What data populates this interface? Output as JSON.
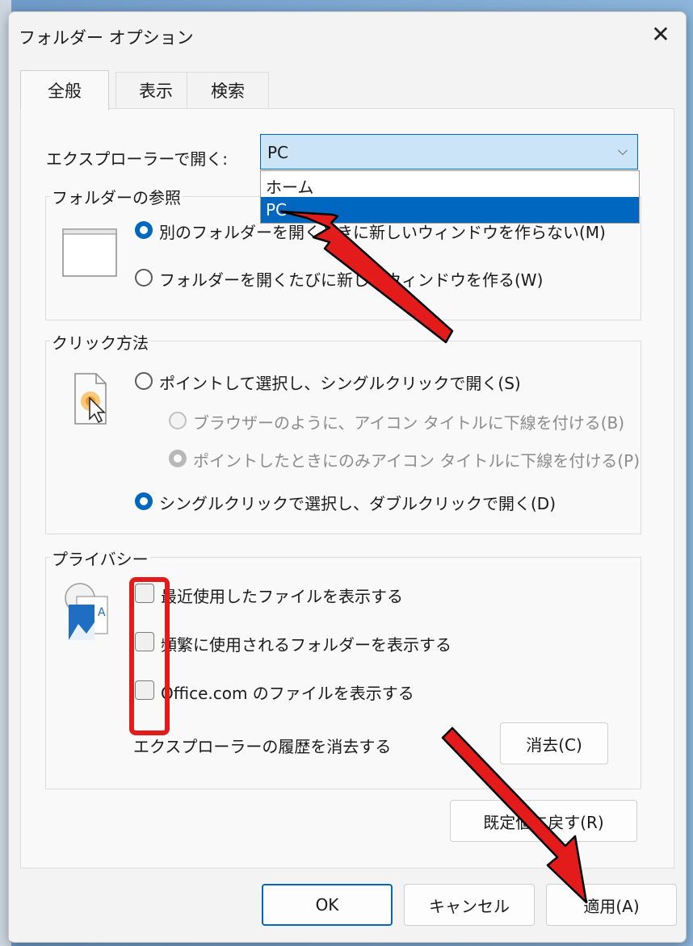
{
  "window": {
    "title": "フォルダー オプション"
  },
  "tabs": [
    {
      "label": "全般",
      "active": true
    },
    {
      "label": "表示",
      "active": false
    },
    {
      "label": "検索",
      "active": false
    }
  ],
  "general": {
    "open_explorer_label": "エクスプローラーで開く:",
    "open_explorer_value": "PC",
    "dropdown_options": [
      "ホーム",
      "PC"
    ],
    "dropdown_selected": "PC",
    "browse_folders": {
      "legend": "フォルダーの参照",
      "options": [
        {
          "label": "別のフォルダーを開くときに新しいウィンドウを作らない(M)",
          "checked": true
        },
        {
          "label": "フォルダーを開くたびに新しいウィンドウを作る(W)",
          "checked": false
        }
      ]
    },
    "click_method": {
      "legend": "クリック方法",
      "options": [
        {
          "label": "ポイントして選択し、シングルクリックで開く(S)",
          "checked": false,
          "enabled": true
        },
        {
          "label": "ブラウザーのように、アイコン タイトルに下線を付ける(B)",
          "checked": false,
          "enabled": false
        },
        {
          "label": "ポイントしたときにのみアイコン タイトルに下線を付ける(P)",
          "checked": true,
          "enabled": false
        },
        {
          "label": "シングルクリックで選択し、ダブルクリックで開く(D)",
          "checked": true,
          "enabled": true
        }
      ]
    },
    "privacy": {
      "legend": "プライバシー",
      "checkboxes": [
        {
          "label": "最近使用したファイルを表示する",
          "checked": false
        },
        {
          "label": "頻繁に使用されるフォルダーを表示する",
          "checked": false
        },
        {
          "label": "Office.com のファイルを表示する",
          "checked": false
        }
      ],
      "clear_history_label": "エクスプローラーの履歴を消去する",
      "clear_button": "消去(C)"
    },
    "restore_defaults_button": "既定値に戻す(R)"
  },
  "footer": {
    "ok": "OK",
    "cancel": "キャンセル",
    "apply": "適用(A)"
  },
  "colors": {
    "accent": "#0067c0",
    "annotation": "#e31b1b"
  }
}
